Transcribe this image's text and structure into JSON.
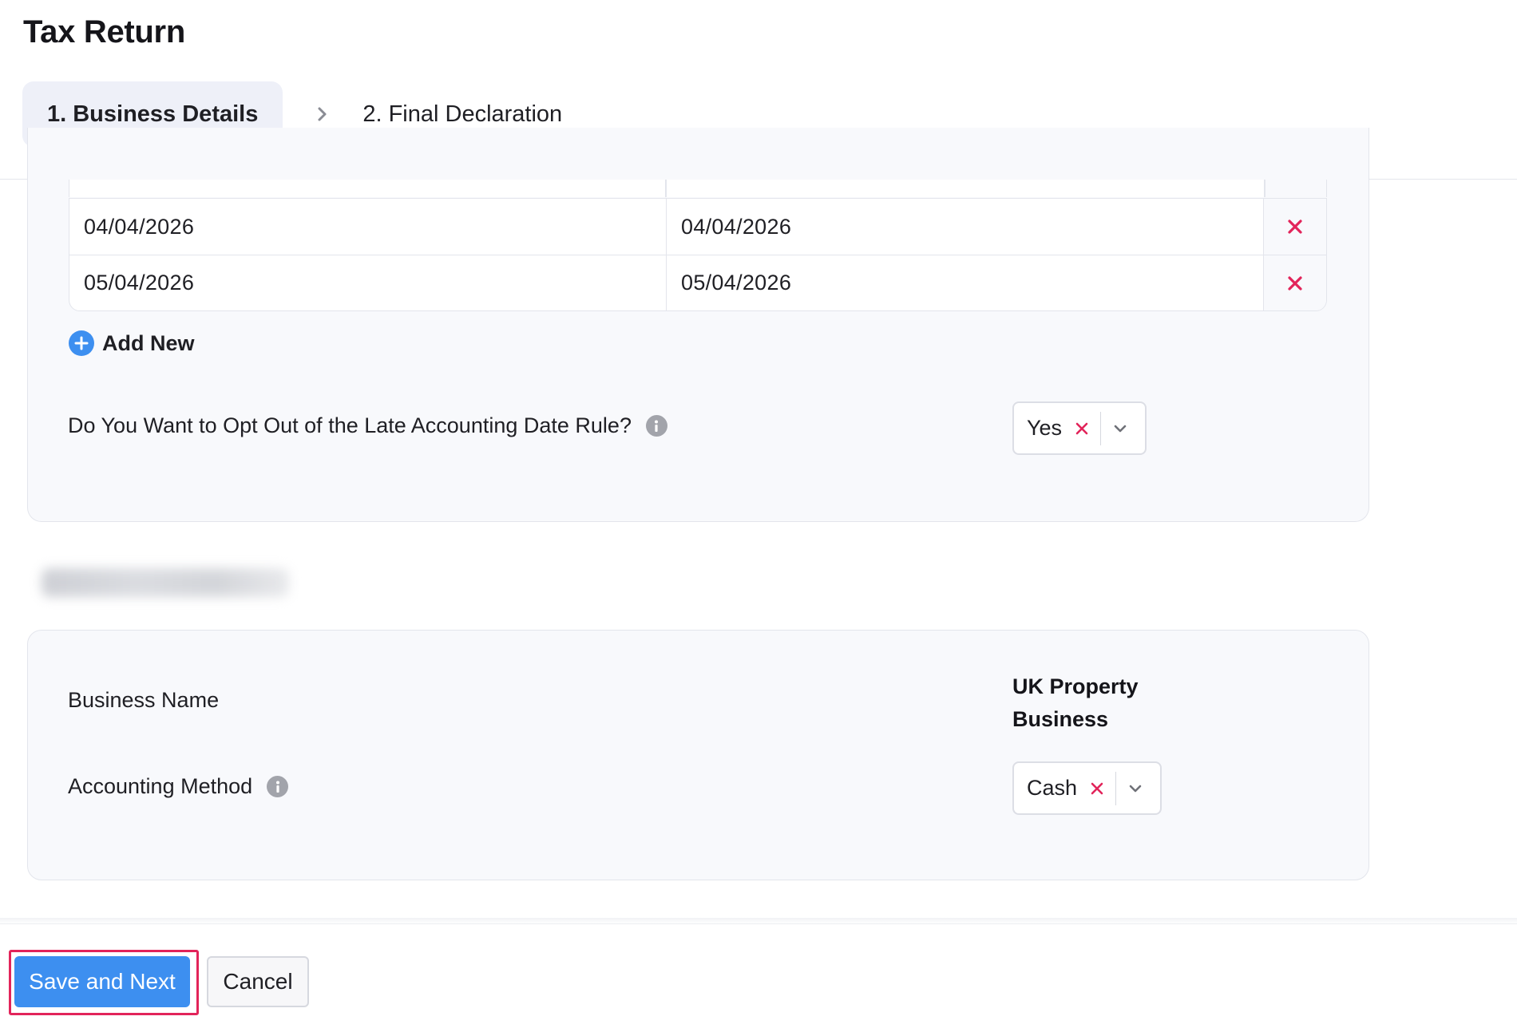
{
  "page": {
    "title": "Tax Return"
  },
  "stepper": {
    "steps": [
      {
        "label": "1. Business Details",
        "active": true
      },
      {
        "label": "2. Final Declaration",
        "active": false
      }
    ]
  },
  "date_table": {
    "rows": [
      {
        "start": "04/04/2026",
        "end": "04/04/2026"
      },
      {
        "start": "05/04/2026",
        "end": "05/04/2026"
      }
    ],
    "add_new_label": "Add New"
  },
  "late_accounting": {
    "question": "Do You Want to Opt Out of the Late Accounting Date Rule?",
    "selected": "Yes"
  },
  "business": {
    "name_label": "Business Name",
    "name_value": "UK Property Business",
    "method_label": "Accounting Method",
    "method_selected": "Cash"
  },
  "footer": {
    "save_label": "Save and Next",
    "cancel_label": "Cancel"
  },
  "colors": {
    "primary": "#3d8ff0",
    "danger": "#e2245a",
    "active_step_bg": "#eef0f8"
  }
}
